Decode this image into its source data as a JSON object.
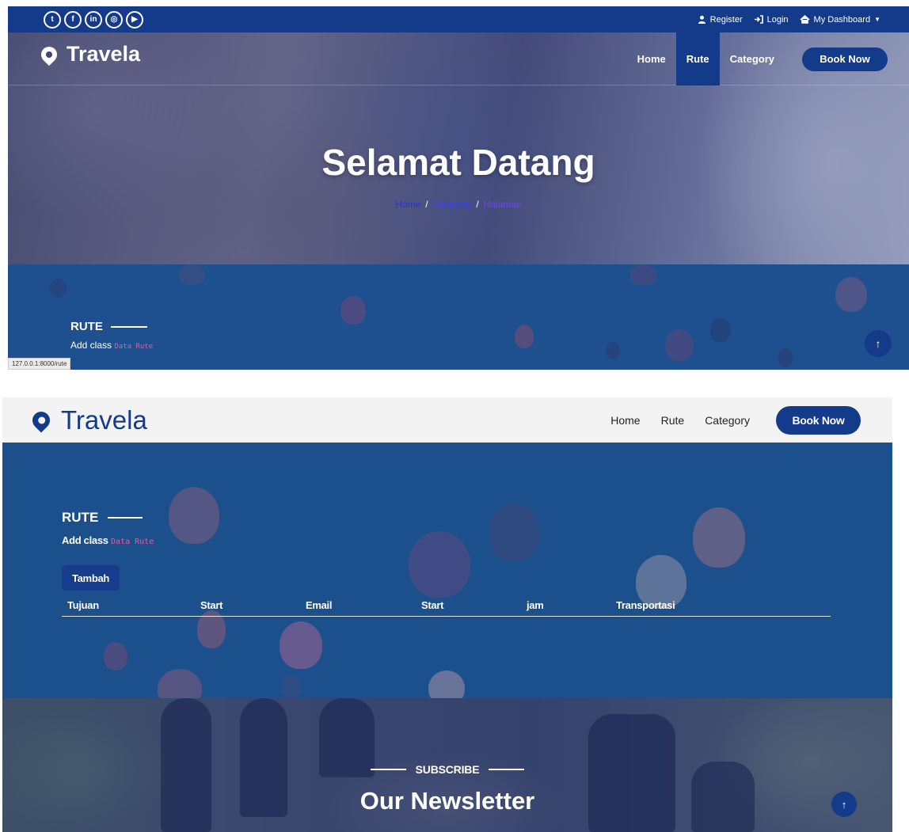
{
  "screen1": {
    "topbar": {
      "social_icons": [
        "twitter-icon",
        "facebook-icon",
        "linkedin-icon",
        "instagram-icon",
        "youtube-icon"
      ],
      "social_glyphs": [
        "t",
        "f",
        "in",
        "◎",
        "▶"
      ],
      "register_label": "Register",
      "login_label": "Login",
      "dashboard_label": "My Dashboard"
    },
    "nav": {
      "brand": "Travela",
      "items": [
        "Home",
        "Rute",
        "Category"
      ],
      "active_item": "Rute",
      "book_now": "Book Now"
    },
    "hero": {
      "title": "Selamat Datang",
      "breadcrumb": [
        "Home",
        "Category",
        "Halaman"
      ],
      "separator": "/"
    },
    "section": {
      "title": "RUTE",
      "add_class_text": "Add class",
      "code_text": "Data Rute"
    },
    "status_url": "127.0.0.1:8000/rute",
    "scroll_top_glyph": "↑"
  },
  "screen2": {
    "nav": {
      "brand": "Travela",
      "items": [
        "Home",
        "Rute",
        "Category"
      ],
      "book_now": "Book Now"
    },
    "section": {
      "title": "RUTE",
      "add_class_text": "Add class",
      "code_text": "Data Rute",
      "add_button": "Tambah",
      "table_headers": [
        "Tujuan",
        "Start",
        "Email",
        "Start",
        "jam",
        "Transportasi"
      ]
    },
    "newsletter": {
      "label": "SUBSCRIBE",
      "title": "Our Newsletter"
    },
    "scroll_top_glyph": "↑"
  },
  "colors": {
    "brand_blue": "#143a8a",
    "section_blue": "#1c508c",
    "code_pink": "#e95ca0"
  }
}
